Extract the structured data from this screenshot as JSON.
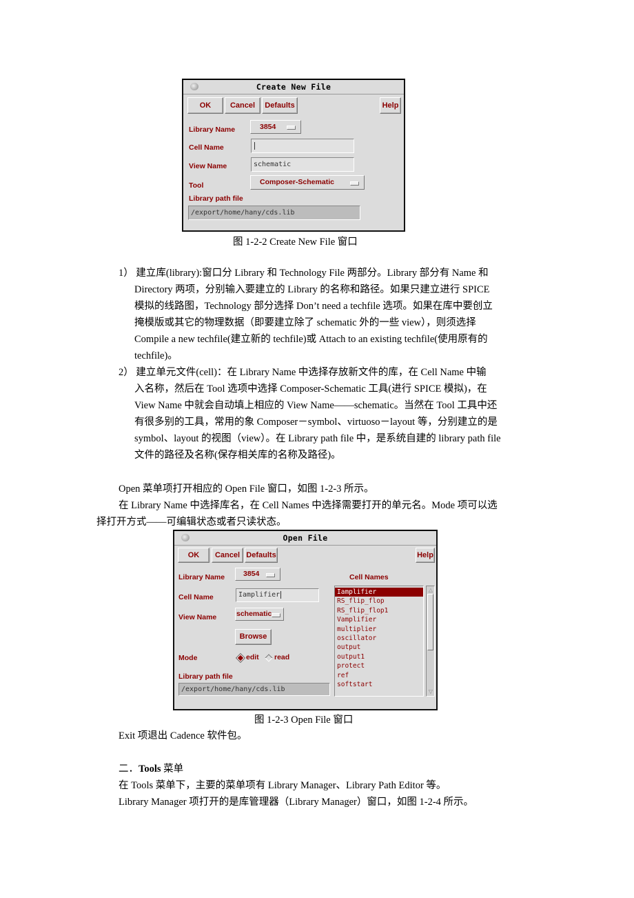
{
  "figure1": {
    "window_title": "Create New File",
    "buttons": {
      "ok": "OK",
      "cancel": "Cancel",
      "defaults": "Defaults",
      "help": "Help"
    },
    "fields": {
      "library_name_label": "Library Name",
      "library_name_value": "3854",
      "cell_name_label": "Cell Name",
      "cell_name_value": "",
      "view_name_label": "View Name",
      "view_name_value": "schematic",
      "tool_label": "Tool",
      "tool_value": "Composer-Schematic",
      "library_path_label": "Library path file",
      "library_path_value": "/export/home/hany/cds.lib"
    },
    "caption": "图 1-2-2 Create New File  窗口"
  },
  "paragraphs": {
    "item1": [
      "1）  建立库(library):窗口分 Library 和 Technology File  两部分。Library 部分有 Name 和",
      "Directory 两项，分别输入要建立的 Library 的名称和路径。如果只建立进行 SPICE",
      "模拟的线路图，Technology 部分选择  Don’t need a techfile  选项。如果在库中要创立",
      "掩模版或其它的物理数据（即要建立除了 schematic 外的一些 view），则须选择",
      "Compile a new techfile(建立新的 techfile)或 Attach to an existing techfile(使用原有的",
      "techfile)。"
    ],
    "item2": [
      "2）  建立单元文件(cell)：在 Library Name  中选择存放新文件的库，在 Cell Name 中输",
      "入名称，然后在 Tool 选项中选择 Composer-Schematic 工具(进行 SPICE 模拟)，在",
      "View Name 中就会自动填上相应的 View Name——schematic。当然在 Tool 工具中还",
      "有很多别的工具，常用的象 Composer－symbol、virtuoso－layout 等，分别建立的是",
      "symbol、layout 的视图（view）。在 Library path file 中，是系统自建的 library path file",
      "文件的路径及名称(保存相关库的名称及路径)。"
    ],
    "open_intro": "Open 菜单项打开相应的 Open File 窗口，如图 1-2-3 所示。",
    "open_desc_1": "在 Library Name 中选择库名，在 Cell Names 中选择需要打开的单元名。Mode 项可以选",
    "open_desc_2": "择打开方式——可编辑状态或者只读状态。",
    "exit": "Exit 项退出 Cadence 软件包。",
    "section_prefix": "二．",
    "section_bold": "Tools",
    "section_suffix": " 菜单",
    "tools_desc": "在 Tools 菜单下，主要的菜单项有 Library Manager、Library Path Editor 等。",
    "libmgr_desc": "Library Manager 项打开的是库管理器（Library Manager）窗口，如图 1-2-4 所示。"
  },
  "figure2": {
    "window_title": "Open File",
    "buttons": {
      "ok": "OK",
      "cancel": "Cancel",
      "defaults": "Defaults",
      "help": "Help",
      "browse": "Browse"
    },
    "fields": {
      "library_name_label": "Library Name",
      "library_name_value": "3854",
      "cell_name_label": "Cell Name",
      "cell_name_value": "Iamplifier",
      "view_name_label": "View Name",
      "view_name_value": "schematic",
      "mode_label": "Mode",
      "mode_edit": "edit",
      "mode_read": "read",
      "mode_selected": "edit",
      "library_path_label": "Library path file",
      "library_path_value": "/export/home/hany/cds.lib"
    },
    "cell_names_label": "Cell Names",
    "cell_names": [
      "Iamplifier",
      "RS_flip_flop",
      "RS_flip_flop1",
      "Vamplifier",
      "multiplier",
      "oscillator",
      "output",
      "output1",
      "protect",
      "ref",
      "softstart"
    ],
    "selected_cell": "Iamplifier",
    "caption": "图  1-2-3    Open File 窗口"
  }
}
